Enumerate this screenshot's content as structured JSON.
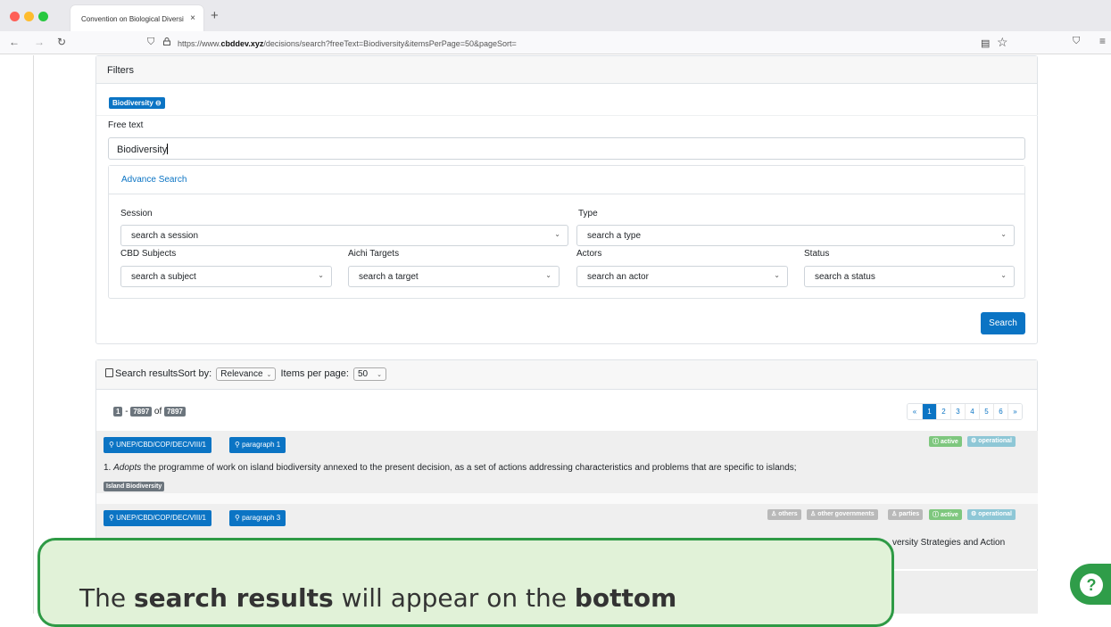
{
  "browser": {
    "tab_title": "Convention on Biological Diversity",
    "tab_close": "×",
    "new_tab": "+",
    "url_prefix": "https://www.",
    "url_domain": "cbddev.xyz",
    "url_path": "/decisions/search?freeText=Biodiversity&itemsPerPage=50&pageSort="
  },
  "filters": {
    "header": "Filters",
    "active_chip": "Biodiversity",
    "free_text_label": "Free text",
    "free_text_value": "Biodiversity",
    "advance_search_label": "Advance Search",
    "session_label": "Session",
    "session_value": "search a session",
    "type_label": "Type",
    "type_value": "search a type",
    "subjects_label": "CBD Subjects",
    "subjects_value": "search a subject",
    "aichi_label": "Aichi Targets",
    "aichi_value": "search a target",
    "actors_label": "Actors",
    "actors_value": "search an actor",
    "status_label": "Status",
    "status_value": "search a status",
    "search_button": "Search"
  },
  "results": {
    "header_label": "Search results",
    "sort_label": "Sort by:",
    "sort_value": "Relevance",
    "per_page_label": "Items per page:",
    "per_page_value": "50",
    "range_start": "1",
    "range_sep": " - ",
    "range_end": "7897",
    "of_label": " of ",
    "total": "7897",
    "pagination": {
      "prev": "«",
      "pages": [
        "1",
        "2",
        "3",
        "4",
        "5",
        "6"
      ],
      "next": "»",
      "active_page": "1"
    },
    "items": [
      {
        "decision": "UNEP/CBD/COP/DEC/VIII/1",
        "paragraph": "paragraph 1",
        "status_tags": [
          "active",
          "operational"
        ],
        "text_number": "1. ",
        "text_verb": "Adopts",
        "text_rest": " the programme of work on island biodiversity annexed to the present decision, as a set of actions addressing characteristics and problems that are specific to islands;",
        "subject": "Island Biodiversity"
      },
      {
        "decision": "UNEP/CBD/COP/DEC/VIII/1",
        "paragraph": "paragraph 3",
        "actor_tags": [
          "others",
          "other governments",
          "parties"
        ],
        "status_tags": [
          "active",
          "operational"
        ],
        "text_visible": "versity Strategies and Action"
      }
    ]
  },
  "tutorial": {
    "text_1": "The ",
    "bold_1": "search results",
    "text_2": " will appear on the ",
    "bold_2": "bottom"
  },
  "help": {
    "glyph": "?"
  },
  "colors": {
    "primary": "#0b74c4",
    "success_tag": "#7ec77e",
    "info_tag": "#8ec7d6",
    "tutorial_border": "#2e9a45",
    "tutorial_bg": "#e1f2d8"
  }
}
